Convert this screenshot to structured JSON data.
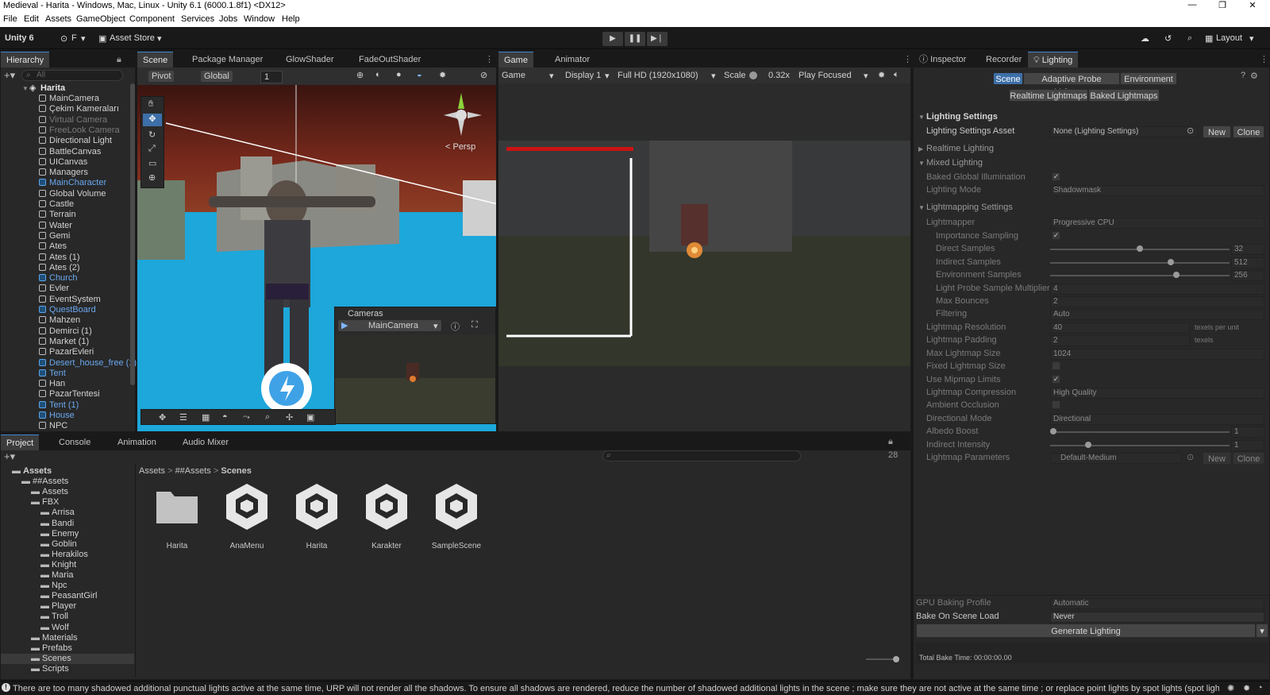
{
  "window": {
    "title": "Medieval - Harita - Windows, Mac, Linux - Unity 6.1 (6000.1.8f1) <DX12>"
  },
  "menu": [
    "File",
    "Edit",
    "Assets",
    "GameObject",
    "Component",
    "Services",
    "Jobs",
    "Window",
    "Help"
  ],
  "toolbar": {
    "unity_label": "Unity 6",
    "account_label": "F",
    "asset_store_label": "Asset Store",
    "layout_label": "Layout"
  },
  "hierarchy": {
    "tab": "Hierarchy",
    "search_placeholder": "All",
    "scene": "Harita",
    "items": [
      {
        "label": "MainCamera",
        "style": "normal"
      },
      {
        "label": "Çekim Kameraları",
        "style": "normal"
      },
      {
        "label": "Virtual Camera",
        "style": "grey"
      },
      {
        "label": "FreeLook Camera",
        "style": "grey"
      },
      {
        "label": "Directional Light",
        "style": "normal"
      },
      {
        "label": "BattleCanvas",
        "style": "normal"
      },
      {
        "label": "UICanvas",
        "style": "normal"
      },
      {
        "label": "Managers",
        "style": "normal"
      },
      {
        "label": "MainCharacter",
        "style": "blue"
      },
      {
        "label": "Global Volume",
        "style": "normal"
      },
      {
        "label": "Castle",
        "style": "normal"
      },
      {
        "label": "Terrain",
        "style": "normal"
      },
      {
        "label": "Water",
        "style": "normal"
      },
      {
        "label": "Gemi",
        "style": "normal"
      },
      {
        "label": "Ates",
        "style": "normal"
      },
      {
        "label": "Ates (1)",
        "style": "normal"
      },
      {
        "label": "Ates (2)",
        "style": "normal"
      },
      {
        "label": "Church",
        "style": "blue"
      },
      {
        "label": "Evler",
        "style": "normal"
      },
      {
        "label": "EventSystem",
        "style": "normal"
      },
      {
        "label": "QuestBoard",
        "style": "blue"
      },
      {
        "label": "Mahzen",
        "style": "normal"
      },
      {
        "label": "Demirci (1)",
        "style": "normal"
      },
      {
        "label": "Market (1)",
        "style": "normal"
      },
      {
        "label": "PazarEvleri",
        "style": "normal"
      },
      {
        "label": "Desert_house_free (1)",
        "style": "blue"
      },
      {
        "label": "Tent",
        "style": "blue"
      },
      {
        "label": "Han",
        "style": "normal"
      },
      {
        "label": "PazarTentesi",
        "style": "normal"
      },
      {
        "label": "Tent (1)",
        "style": "blue"
      },
      {
        "label": "House",
        "style": "blue"
      },
      {
        "label": "NPC",
        "style": "normal"
      }
    ]
  },
  "scene_view": {
    "tabs": [
      "Scene",
      "Package Manager",
      "GlowShader",
      "FadeOutShader"
    ],
    "pivot": "Pivot",
    "global": "Global",
    "grid_value": "1",
    "persp": "< Persp",
    "cameras_overlay": {
      "title": "Cameras",
      "camera": "MainCamera"
    }
  },
  "game_view": {
    "tabs": [
      "Game",
      "Animator"
    ],
    "mode": "Game",
    "display": "Display 1",
    "resolution": "Full HD (1920x1080)",
    "scale_label": "Scale",
    "scale_value": "0.32x",
    "play_mode": "Play Focused"
  },
  "project": {
    "tabs": [
      "Project",
      "Console",
      "Animation",
      "Audio Mixer"
    ],
    "tree": [
      {
        "label": "Assets",
        "depth": 0,
        "bold": true
      },
      {
        "label": "##Assets",
        "depth": 1
      },
      {
        "label": "Assets",
        "depth": 2
      },
      {
        "label": "FBX",
        "depth": 2
      },
      {
        "label": "Arrisa",
        "depth": 3
      },
      {
        "label": "Bandi",
        "depth": 3
      },
      {
        "label": "Enemy",
        "depth": 3
      },
      {
        "label": "Goblin",
        "depth": 3
      },
      {
        "label": "Herakilos",
        "depth": 3
      },
      {
        "label": "Knight",
        "depth": 3
      },
      {
        "label": "Maria",
        "depth": 3
      },
      {
        "label": "Npc",
        "depth": 3
      },
      {
        "label": "PeasantGirl",
        "depth": 3
      },
      {
        "label": "Player",
        "depth": 3
      },
      {
        "label": "Troll",
        "depth": 3
      },
      {
        "label": "Wolf",
        "depth": 3
      },
      {
        "label": "Materials",
        "depth": 2
      },
      {
        "label": "Prefabs",
        "depth": 2
      },
      {
        "label": "Scenes",
        "depth": 2,
        "selected": true
      },
      {
        "label": "Scripts",
        "depth": 2
      }
    ],
    "breadcrumb": [
      "Assets",
      "##Assets",
      "Scenes"
    ],
    "hidden_count": "28",
    "assets": [
      {
        "name": "Harita",
        "kind": "folder"
      },
      {
        "name": "AnaMenu",
        "kind": "scene"
      },
      {
        "name": "Harita",
        "kind": "scene"
      },
      {
        "name": "Karakter",
        "kind": "scene"
      },
      {
        "name": "SampleScene",
        "kind": "scene"
      }
    ]
  },
  "inspector": {
    "tabs": [
      "Inspector",
      "Recorder",
      "Lighting"
    ],
    "subtabs_row1": [
      "Scene",
      "Adaptive Probe Volumes",
      "Environment"
    ],
    "subtabs_row2": [
      "Realtime Lightmaps",
      "Baked Lightmaps"
    ],
    "lighting_settings": "Lighting Settings",
    "lighting_settings_asset": {
      "label": "Lighting Settings Asset",
      "value": "None (Lighting Settings)",
      "new": "New",
      "clone": "Clone"
    },
    "realtime_lighting": "Realtime Lighting",
    "mixed_lighting": "Mixed Lighting",
    "baked_gi": {
      "label": "Baked Global Illumination",
      "checked": true
    },
    "lighting_mode": {
      "label": "Lighting Mode",
      "value": "Shadowmask"
    },
    "lightmapping_settings": "Lightmapping Settings",
    "lightmapper": {
      "label": "Lightmapper",
      "value": "Progressive CPU"
    },
    "importance_sampling": {
      "label": "Importance Sampling",
      "checked": true
    },
    "direct_samples": {
      "label": "Direct Samples",
      "value": "32",
      "level": 0.5
    },
    "indirect_samples": {
      "label": "Indirect Samples",
      "value": "512",
      "level": 0.68
    },
    "environment_samples": {
      "label": "Environment Samples",
      "value": "256",
      "level": 0.71
    },
    "light_probe_multiplier": {
      "label": "Light Probe Sample Multiplier",
      "value": "4"
    },
    "max_bounces": {
      "label": "Max Bounces",
      "value": "2"
    },
    "filtering": {
      "label": "Filtering",
      "value": "Auto"
    },
    "lightmap_resolution": {
      "label": "Lightmap Resolution",
      "value": "40",
      "unit": "texels per unit"
    },
    "lightmap_padding": {
      "label": "Lightmap Padding",
      "value": "2",
      "unit": "texels"
    },
    "max_lightmap_size": {
      "label": "Max Lightmap Size",
      "value": "1024"
    },
    "fixed_lightmap_size": {
      "label": "Fixed Lightmap Size",
      "checked": false
    },
    "use_mipmap_limits": {
      "label": "Use Mipmap Limits",
      "checked": true
    },
    "lightmap_compression": {
      "label": "Lightmap Compression",
      "value": "High Quality"
    },
    "ambient_occlusion": {
      "label": "Ambient Occlusion",
      "checked": false
    },
    "directional_mode": {
      "label": "Directional Mode",
      "value": "Directional"
    },
    "albedo_boost": {
      "label": "Albedo Boost",
      "value": "1",
      "level": 0.0
    },
    "indirect_intensity": {
      "label": "Indirect Intensity",
      "value": "1",
      "level": 0.2
    },
    "lightmap_parameters": {
      "label": "Lightmap Parameters",
      "value": "Default-Medium",
      "new": "New",
      "clone": "Clone"
    },
    "gpu_baking_profile": {
      "label": "GPU Baking Profile",
      "value": "Automatic"
    },
    "bake_on_scene_load": {
      "label": "Bake On Scene Load",
      "value": "Never"
    },
    "generate_button": "Generate Lighting",
    "total_bake_time": "Total Bake Time: 00:00:00.00"
  },
  "status": {
    "message": "There are too many shadowed additional punctual lights active at the same time, URP will not render all the shadows. To ensure all shadows are rendered, reduce the number of shadowed additional lights in the scene ; make sure they are not active at the same time ; or replace point lights by spot lights (spot lights us"
  },
  "colors": {
    "accent": "#3d87d5",
    "prefab_blue": "#6aa8f0",
    "panel": "#282828",
    "sky_red": "#7a2216",
    "water": "#1aa6d8"
  }
}
